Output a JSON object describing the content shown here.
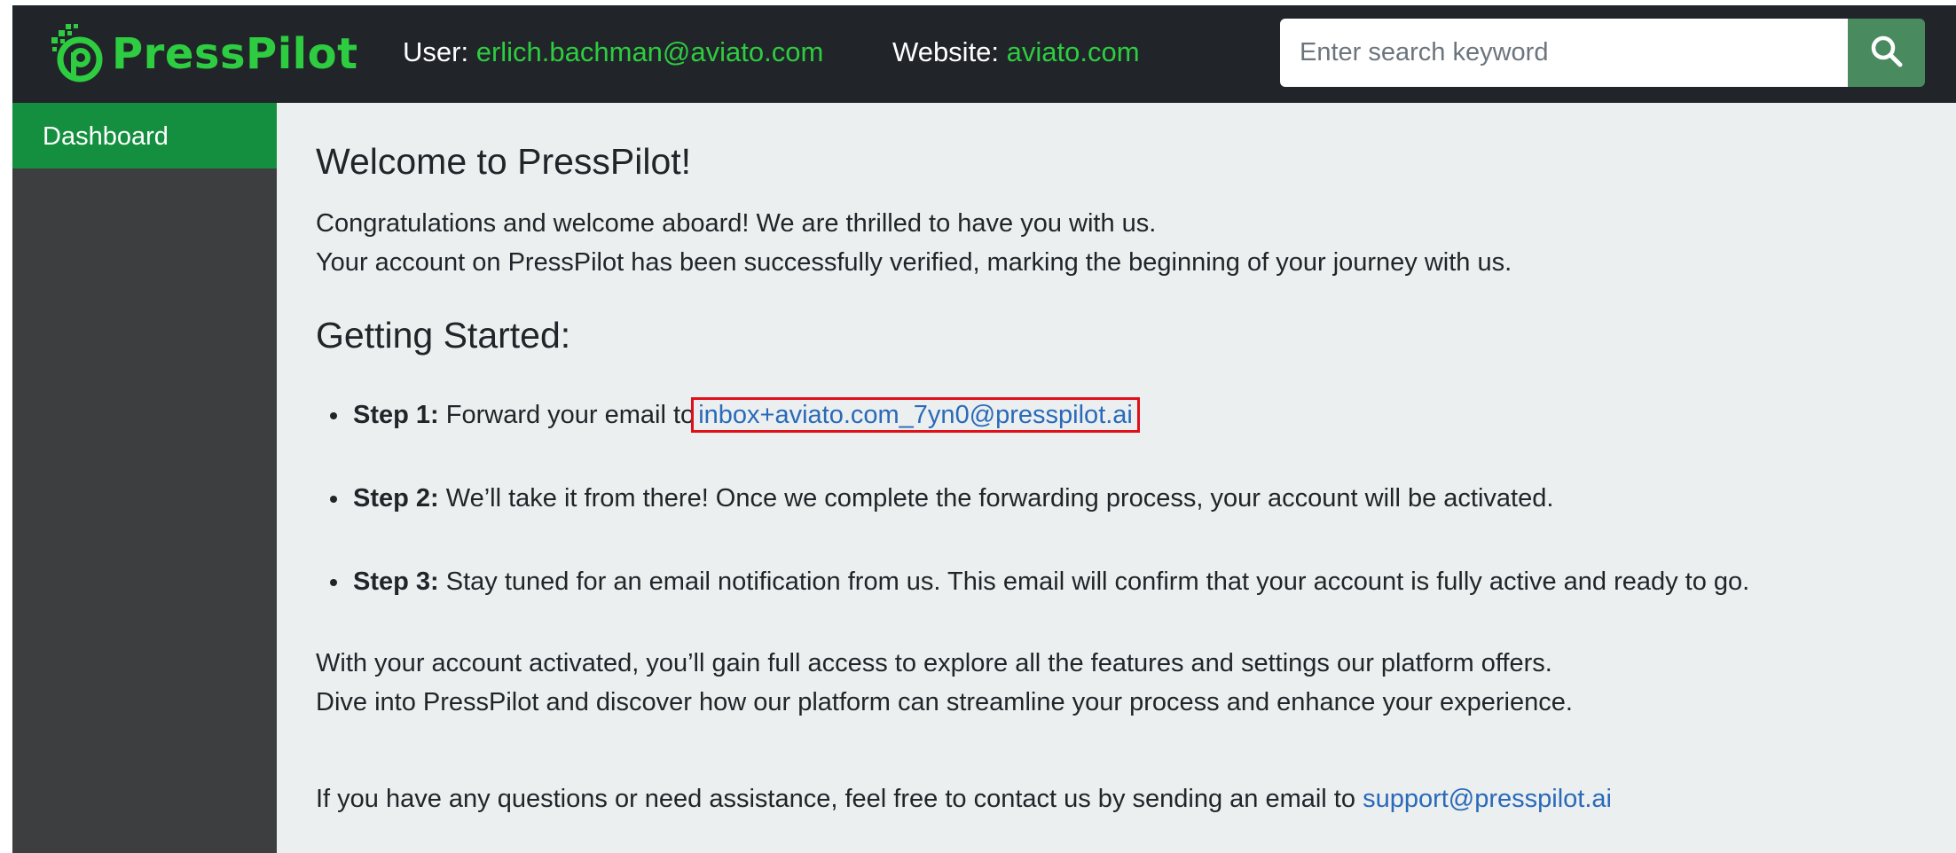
{
  "header": {
    "brand": "PressPilot",
    "user_label": "User:",
    "user_value": "erlich.bachman@aviato.com",
    "website_label": "Website:",
    "website_value": "aviato.com",
    "search_placeholder": "Enter search keyword",
    "search_icon": "search-icon"
  },
  "sidebar": {
    "items": [
      {
        "label": "Dashboard",
        "active": true
      }
    ]
  },
  "main": {
    "title": "Welcome to PressPilot!",
    "intro_line_1": "Congratulations and welcome aboard! We are thrilled to have you with us.",
    "intro_line_2": "Your account on PressPilot has been successfully verified, marking the beginning of your journey with us.",
    "section_title": "Getting Started:",
    "steps": [
      {
        "label": "Step 1:",
        "text": "Forward your email to",
        "link": "inbox+aviato.com_7yn0@presspilot.ai"
      },
      {
        "label": "Step 2:",
        "text": "We’ll take it from there! Once we complete the forwarding process, your account will be activated."
      },
      {
        "label": "Step 3:",
        "text": "Stay tuned for an email notification from us. This email will confirm that your account is fully active and ready to go."
      }
    ],
    "outro_line_1": "With your account activated, you’ll gain full access to explore all the features and settings our platform offers.",
    "outro_line_2": "Dive into PressPilot and discover how our platform can streamline your process and enhance your experience.",
    "contact_text": "If you have any questions or need assistance, feel free to contact us by sending an email to",
    "contact_link": "support@presspilot.ai"
  },
  "colors": {
    "topbar": "#212529",
    "brand_green": "#2ecc40",
    "sidebar": "#3d3e40",
    "sidebar_active": "#148f3f",
    "search_button": "#4a8a5f",
    "link": "#2a6ab8",
    "highlight_box": "#e0101a"
  }
}
